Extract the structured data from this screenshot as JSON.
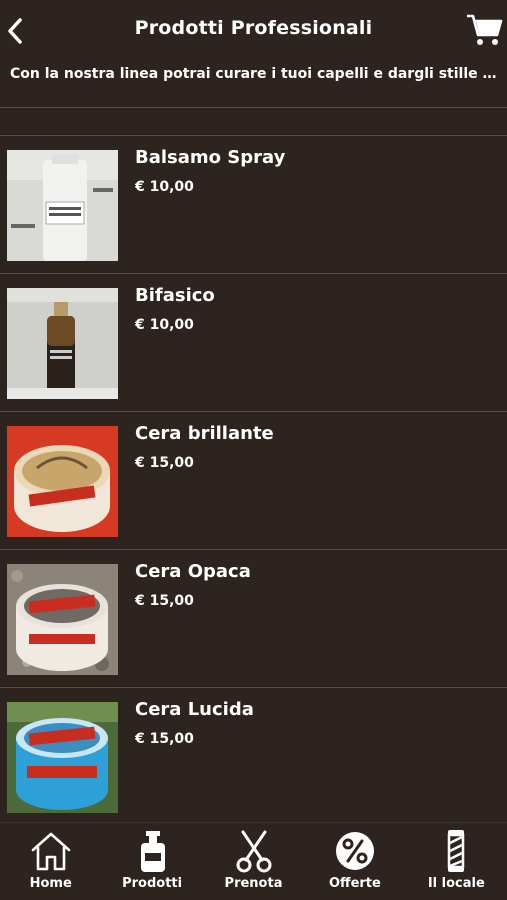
{
  "header": {
    "title": "Prodotti Professionali",
    "back_icon": "chevron-left-icon",
    "cart_icon": "cart-icon"
  },
  "intro": "Con la nostra linea potrai curare i tuoi capelli e dargli stille n...",
  "products": [
    {
      "name": "Balsamo Spray",
      "price": "€ 10,00",
      "image": "spray-bottle"
    },
    {
      "name": "Bifasico",
      "price": "€ 10,00",
      "image": "dark-bottle"
    },
    {
      "name": "Cera brillante",
      "price": "€ 15,00",
      "image": "pomade-red"
    },
    {
      "name": "Cera Opaca",
      "price": "€ 15,00",
      "image": "pomade-white"
    },
    {
      "name": "Cera Lucida",
      "price": "€ 15,00",
      "image": "pomade-blue"
    }
  ],
  "tabs": [
    {
      "label": "Home",
      "icon": "home-icon"
    },
    {
      "label": "Prodotti",
      "icon": "bottle-icon"
    },
    {
      "label": "Prenota",
      "icon": "scissors-icon"
    },
    {
      "label": "Offerte",
      "icon": "percent-badge-icon"
    },
    {
      "label": "Il locale",
      "icon": "barber-pole-icon"
    }
  ],
  "colors": {
    "background": "#2e241f",
    "divider": "#5a4d46",
    "text": "#ffffff"
  }
}
